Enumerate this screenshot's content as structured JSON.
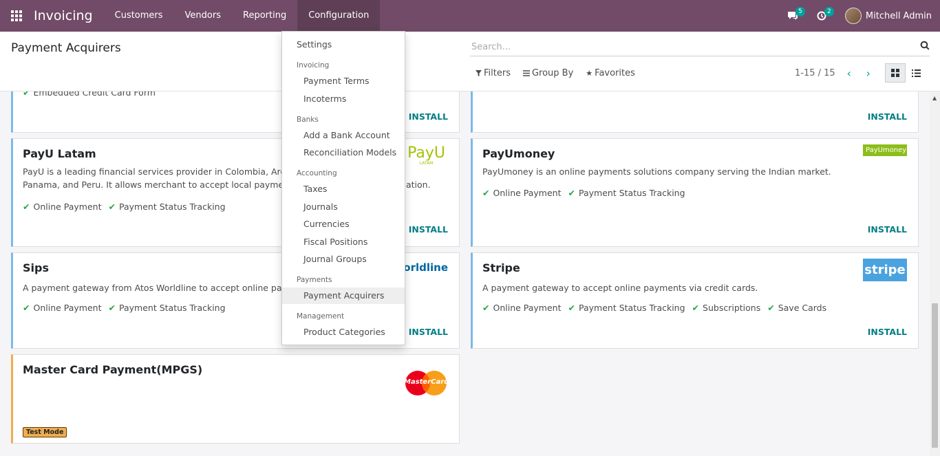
{
  "topbar": {
    "app_title": "Invoicing",
    "menus": [
      "Customers",
      "Vendors",
      "Reporting",
      "Configuration"
    ],
    "messages_count": "5",
    "activities_count": "2",
    "user_name": "Mitchell Admin",
    "color": "#714b67"
  },
  "control_panel": {
    "title": "Payment Acquirers",
    "search_placeholder": "Search...",
    "filters_label": "Filters",
    "group_by_label": "Group By",
    "favorites_label": "Favorites",
    "pager": "1-15 / 15"
  },
  "cards": {
    "c1": {
      "feature": "Embedded Credit Card Form",
      "install": "INSTALL"
    },
    "c2": {
      "install": "INSTALL"
    },
    "payu_latam": {
      "title": "PayU Latam",
      "desc_line1": "PayU is a leading financial services provider in Colombia, Argentin",
      "desc_line2": "Panama, and Peru. It allows merchant to accept local payments w",
      "desc_tail": "ation.",
      "features": [
        "Online Payment",
        "Payment Status Tracking"
      ],
      "install": "INSTALL",
      "logo_text": "PayU",
      "logo_sub": "LATAM"
    },
    "payumoney": {
      "title": "PayUmoney",
      "desc": "PayUmoney is an online payments solutions company serving the Indian market.",
      "features": [
        "Online Payment",
        "Payment Status Tracking"
      ],
      "install": "INSTALL",
      "logo_text": "PayUmoney"
    },
    "sips": {
      "title": "Sips",
      "desc": "A payment gateway from Atos Worldline to accept online paymen",
      "features": [
        "Online Payment",
        "Payment Status Tracking"
      ],
      "install": "INSTALL",
      "logo_text": "worldline"
    },
    "stripe": {
      "title": "Stripe",
      "desc": "A payment gateway to accept online payments via credit cards.",
      "features": [
        "Online Payment",
        "Payment Status Tracking",
        "Subscriptions",
        "Save Cards"
      ],
      "install": "INSTALL",
      "logo_text": "stripe"
    },
    "mpgs": {
      "title": "Master Card Payment(MPGS)",
      "badge": "Test Mode",
      "logo_text": "MasterCard"
    }
  },
  "dropdown": {
    "settings": "Settings",
    "invoicing_header": "Invoicing",
    "payment_terms": "Payment Terms",
    "incoterms": "Incoterms",
    "banks_header": "Banks",
    "add_bank": "Add a Bank Account",
    "reconciliation": "Reconciliation Models",
    "accounting_header": "Accounting",
    "taxes": "Taxes",
    "journals": "Journals",
    "currencies": "Currencies",
    "fiscal_positions": "Fiscal Positions",
    "journal_groups": "Journal Groups",
    "payments_header": "Payments",
    "payment_acquirers": "Payment Acquirers",
    "management_header": "Management",
    "product_categories": "Product Categories"
  }
}
